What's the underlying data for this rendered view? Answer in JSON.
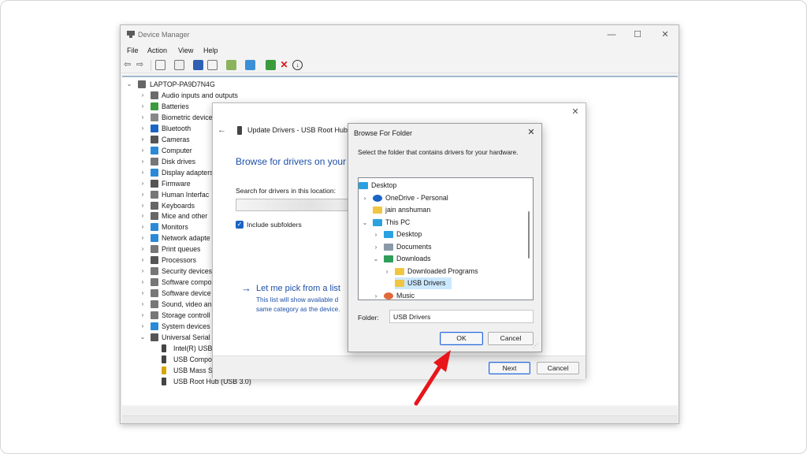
{
  "device_manager": {
    "title": "Device Manager",
    "menu": [
      "File",
      "Action",
      "View",
      "Help"
    ],
    "root": "LAPTOP-PA9D7N4G",
    "categories": [
      {
        "label": "Audio inputs and outputs",
        "icon": "speaker-icon",
        "color": "#6b6b6b"
      },
      {
        "label": "Batteries",
        "icon": "battery-icon",
        "color": "#3c9a3c"
      },
      {
        "label": "Biometric device",
        "icon": "fingerprint-icon",
        "color": "#888888"
      },
      {
        "label": "Bluetooth",
        "icon": "bluetooth-icon",
        "color": "#1a64c4"
      },
      {
        "label": "Cameras",
        "icon": "camera-icon",
        "color": "#555555"
      },
      {
        "label": "Computer",
        "icon": "computer-icon",
        "color": "#2a8ad8"
      },
      {
        "label": "Disk drives",
        "icon": "disk-icon",
        "color": "#777777"
      },
      {
        "label": "Display adapters",
        "icon": "display-icon",
        "color": "#2a8ad8"
      },
      {
        "label": "Firmware",
        "icon": "chip-icon",
        "color": "#555555"
      },
      {
        "label": "Human Interfac",
        "icon": "hid-icon",
        "color": "#777777"
      },
      {
        "label": "Keyboards",
        "icon": "keyboard-icon",
        "color": "#666666"
      },
      {
        "label": "Mice and other",
        "icon": "mouse-icon",
        "color": "#666666"
      },
      {
        "label": "Monitors",
        "icon": "monitor-icon",
        "color": "#2a8ad8"
      },
      {
        "label": "Network adapte",
        "icon": "network-icon",
        "color": "#2a8ad8"
      },
      {
        "label": "Print queues",
        "icon": "printer-icon",
        "color": "#777777"
      },
      {
        "label": "Processors",
        "icon": "processor-icon",
        "color": "#555555"
      },
      {
        "label": "Security devices",
        "icon": "security-icon",
        "color": "#777777"
      },
      {
        "label": "Software compo",
        "icon": "software-icon",
        "color": "#777777"
      },
      {
        "label": "Software device",
        "icon": "software-icon",
        "color": "#777777"
      },
      {
        "label": "Sound, video an",
        "icon": "sound-icon",
        "color": "#777777"
      },
      {
        "label": "Storage controll",
        "icon": "storage-icon",
        "color": "#777777"
      },
      {
        "label": "System devices",
        "icon": "system-icon",
        "color": "#2a8ad8"
      },
      {
        "label": "Universal Serial",
        "icon": "usb-icon",
        "color": "#555555"
      }
    ],
    "usb_children": [
      {
        "label": "Intel(R) USB"
      },
      {
        "label": "USB Compo"
      },
      {
        "label": "USB Mass St"
      },
      {
        "label": "USB Root Hub (USB 3.0)"
      }
    ]
  },
  "wizard": {
    "title": "Update Drivers - USB Root Hub",
    "heading": "Browse for drivers on your",
    "search_label": "Search for drivers in this location:",
    "include_subfolders": "Include subfolders",
    "pick_title": "Let me pick from a list",
    "pick_desc": "This list will show available d same category as the device.",
    "next": "Next",
    "cancel": "Cancel"
  },
  "browse_dialog": {
    "title": "Browse For Folder",
    "instruction": "Select the folder that contains drivers for your hardware.",
    "tree": [
      {
        "label": "Desktop",
        "icon": "desktop-folder-icon"
      },
      {
        "label": "OneDrive - Personal",
        "icon": "cloud-icon"
      },
      {
        "label": "jain anshuman",
        "icon": "folder-icon"
      },
      {
        "label": "This PC",
        "icon": "pc-icon"
      },
      {
        "label": "Desktop",
        "icon": "desktop-folder-icon"
      },
      {
        "label": "Documents",
        "icon": "documents-icon"
      },
      {
        "label": "Downloads",
        "icon": "download-icon"
      },
      {
        "label": "Downloaded Programs",
        "icon": "folder-icon"
      },
      {
        "label": "USB Drivers",
        "icon": "folder-icon"
      },
      {
        "label": "Music",
        "icon": "music-icon"
      }
    ],
    "folder_label": "Folder:",
    "folder_value": "USB Drivers",
    "ok": "OK",
    "cancel": "Cancel"
  },
  "colors": {
    "accent": "#1e4fa8",
    "selection": "#cce8ff",
    "annotation_arrow": "#e8151b"
  }
}
